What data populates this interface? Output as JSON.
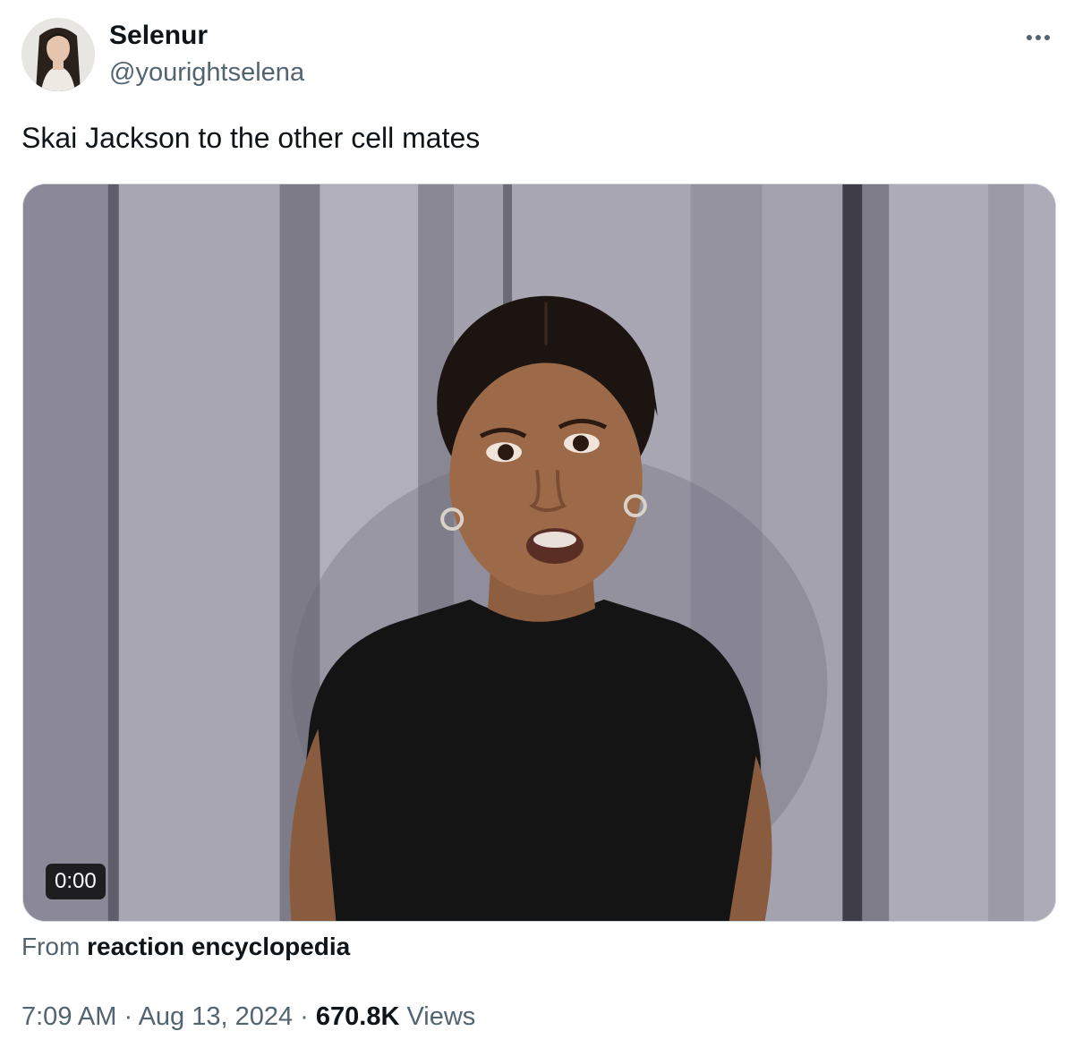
{
  "author": {
    "display_name": "Selenur",
    "handle": "@yourightselena"
  },
  "tweet": {
    "text": "Skai Jackson to the other cell mates"
  },
  "media": {
    "type": "video",
    "duration_label": "0:00",
    "description_icon": "video-thumbnail"
  },
  "attribution": {
    "prefix": "From",
    "source": "reaction encyclopedia"
  },
  "meta": {
    "time": "7:09 AM",
    "separator1": " · ",
    "date": "Aug 13, 2024",
    "separator2": " · ",
    "views_count": "670.8K",
    "views_label": " Views"
  },
  "icons": {
    "more": "more-horizontal-icon"
  },
  "colors": {
    "text_primary": "#0f1419",
    "text_secondary": "#536471",
    "border": "#cfd9de"
  }
}
